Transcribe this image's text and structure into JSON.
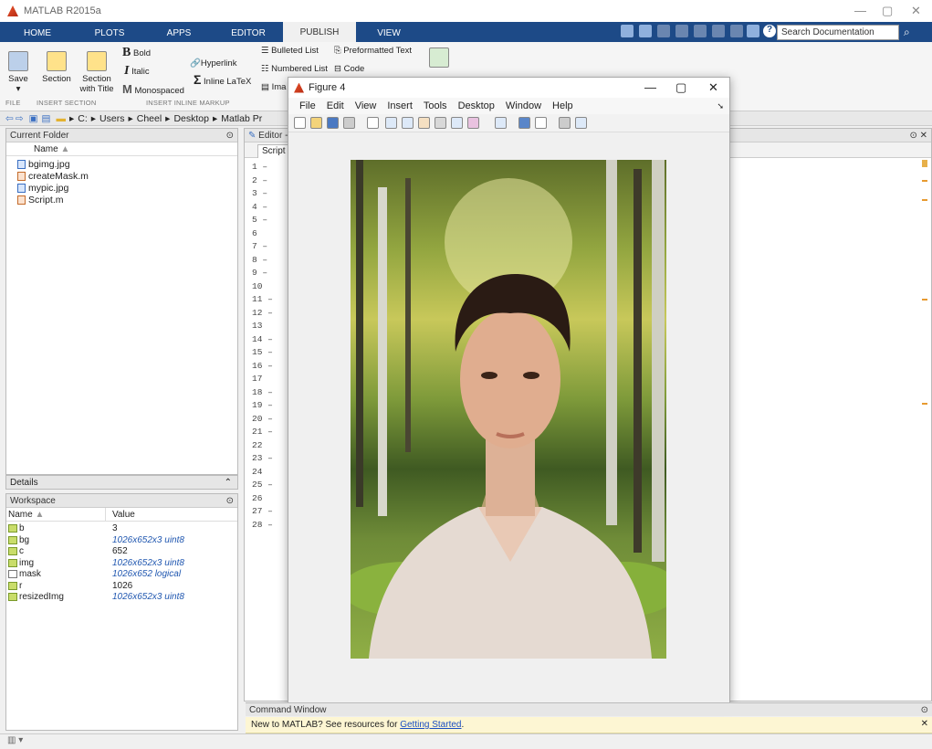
{
  "app": {
    "title": "MATLAB R2015a"
  },
  "tabs": [
    "HOME",
    "PLOTS",
    "APPS",
    "EDITOR",
    "PUBLISH",
    "VIEW"
  ],
  "search": {
    "placeholder": "Search Documentation"
  },
  "ribbon": {
    "save": "Save",
    "section": "Section",
    "section_title": "Section with Title",
    "bold": "Bold",
    "italic": "Italic",
    "monospaced": "Monospaced",
    "hyperlink": "Hyperlink",
    "inline_latex": "Inline LaTeX",
    "bulleted_list": "Bulleted List",
    "numbered_list": "Numbered List",
    "image": "Ima",
    "preformatted_text": "Preformatted Text",
    "code": "Code",
    "sec_file": "FILE",
    "sec_insert_section": "INSERT SECTION",
    "sec_insert_markup": "INSERT INLINE MARKUP"
  },
  "address": {
    "path": [
      "C:",
      "Users",
      "Cheel",
      "Desktop",
      "Matlab Pr"
    ]
  },
  "current_folder": {
    "title": "Current Folder",
    "col_name": "Name",
    "files": [
      "bgimg.jpg",
      "createMask.m",
      "mypic.jpg",
      "Script.m"
    ]
  },
  "details": {
    "title": "Details"
  },
  "workspace": {
    "title": "Workspace",
    "col_name": "Name",
    "col_value": "Value",
    "vars": [
      {
        "name": "b",
        "value": "3",
        "italic": false
      },
      {
        "name": "bg",
        "value": "1026x652x3 uint8",
        "italic": true
      },
      {
        "name": "c",
        "value": "652",
        "italic": false
      },
      {
        "name": "img",
        "value": "1026x652x3 uint8",
        "italic": true
      },
      {
        "name": "mask",
        "value": "1026x652 logical",
        "italic": true
      },
      {
        "name": "r",
        "value": "1026",
        "italic": false
      },
      {
        "name": "resizedImg",
        "value": "1026x652x3 uint8",
        "italic": true
      }
    ]
  },
  "editor": {
    "title": "Editor -",
    "tab": "Script",
    "lines": [
      "1",
      "2",
      "3",
      "4",
      "5",
      "6",
      "7",
      "8",
      "9",
      "10",
      "11",
      "12",
      "13",
      "14",
      "15",
      "16",
      "17",
      "18",
      "19",
      "20",
      "21",
      "22",
      "23",
      "24",
      "25",
      "26",
      "27",
      "28"
    ],
    "dash_lines": [
      1,
      2,
      3,
      4,
      5,
      7,
      8,
      9,
      11,
      12,
      14,
      15,
      16,
      18,
      19,
      20,
      21,
      23,
      25,
      27,
      28
    ]
  },
  "figure": {
    "title": "Figure 4",
    "menu": [
      "File",
      "Edit",
      "View",
      "Insert",
      "Tools",
      "Desktop",
      "Window",
      "Help"
    ]
  },
  "command_window": {
    "title": "Command Window",
    "note_prefix": "New to MATLAB? See resources for ",
    "note_link": "Getting Started",
    "note_suffix": "."
  }
}
